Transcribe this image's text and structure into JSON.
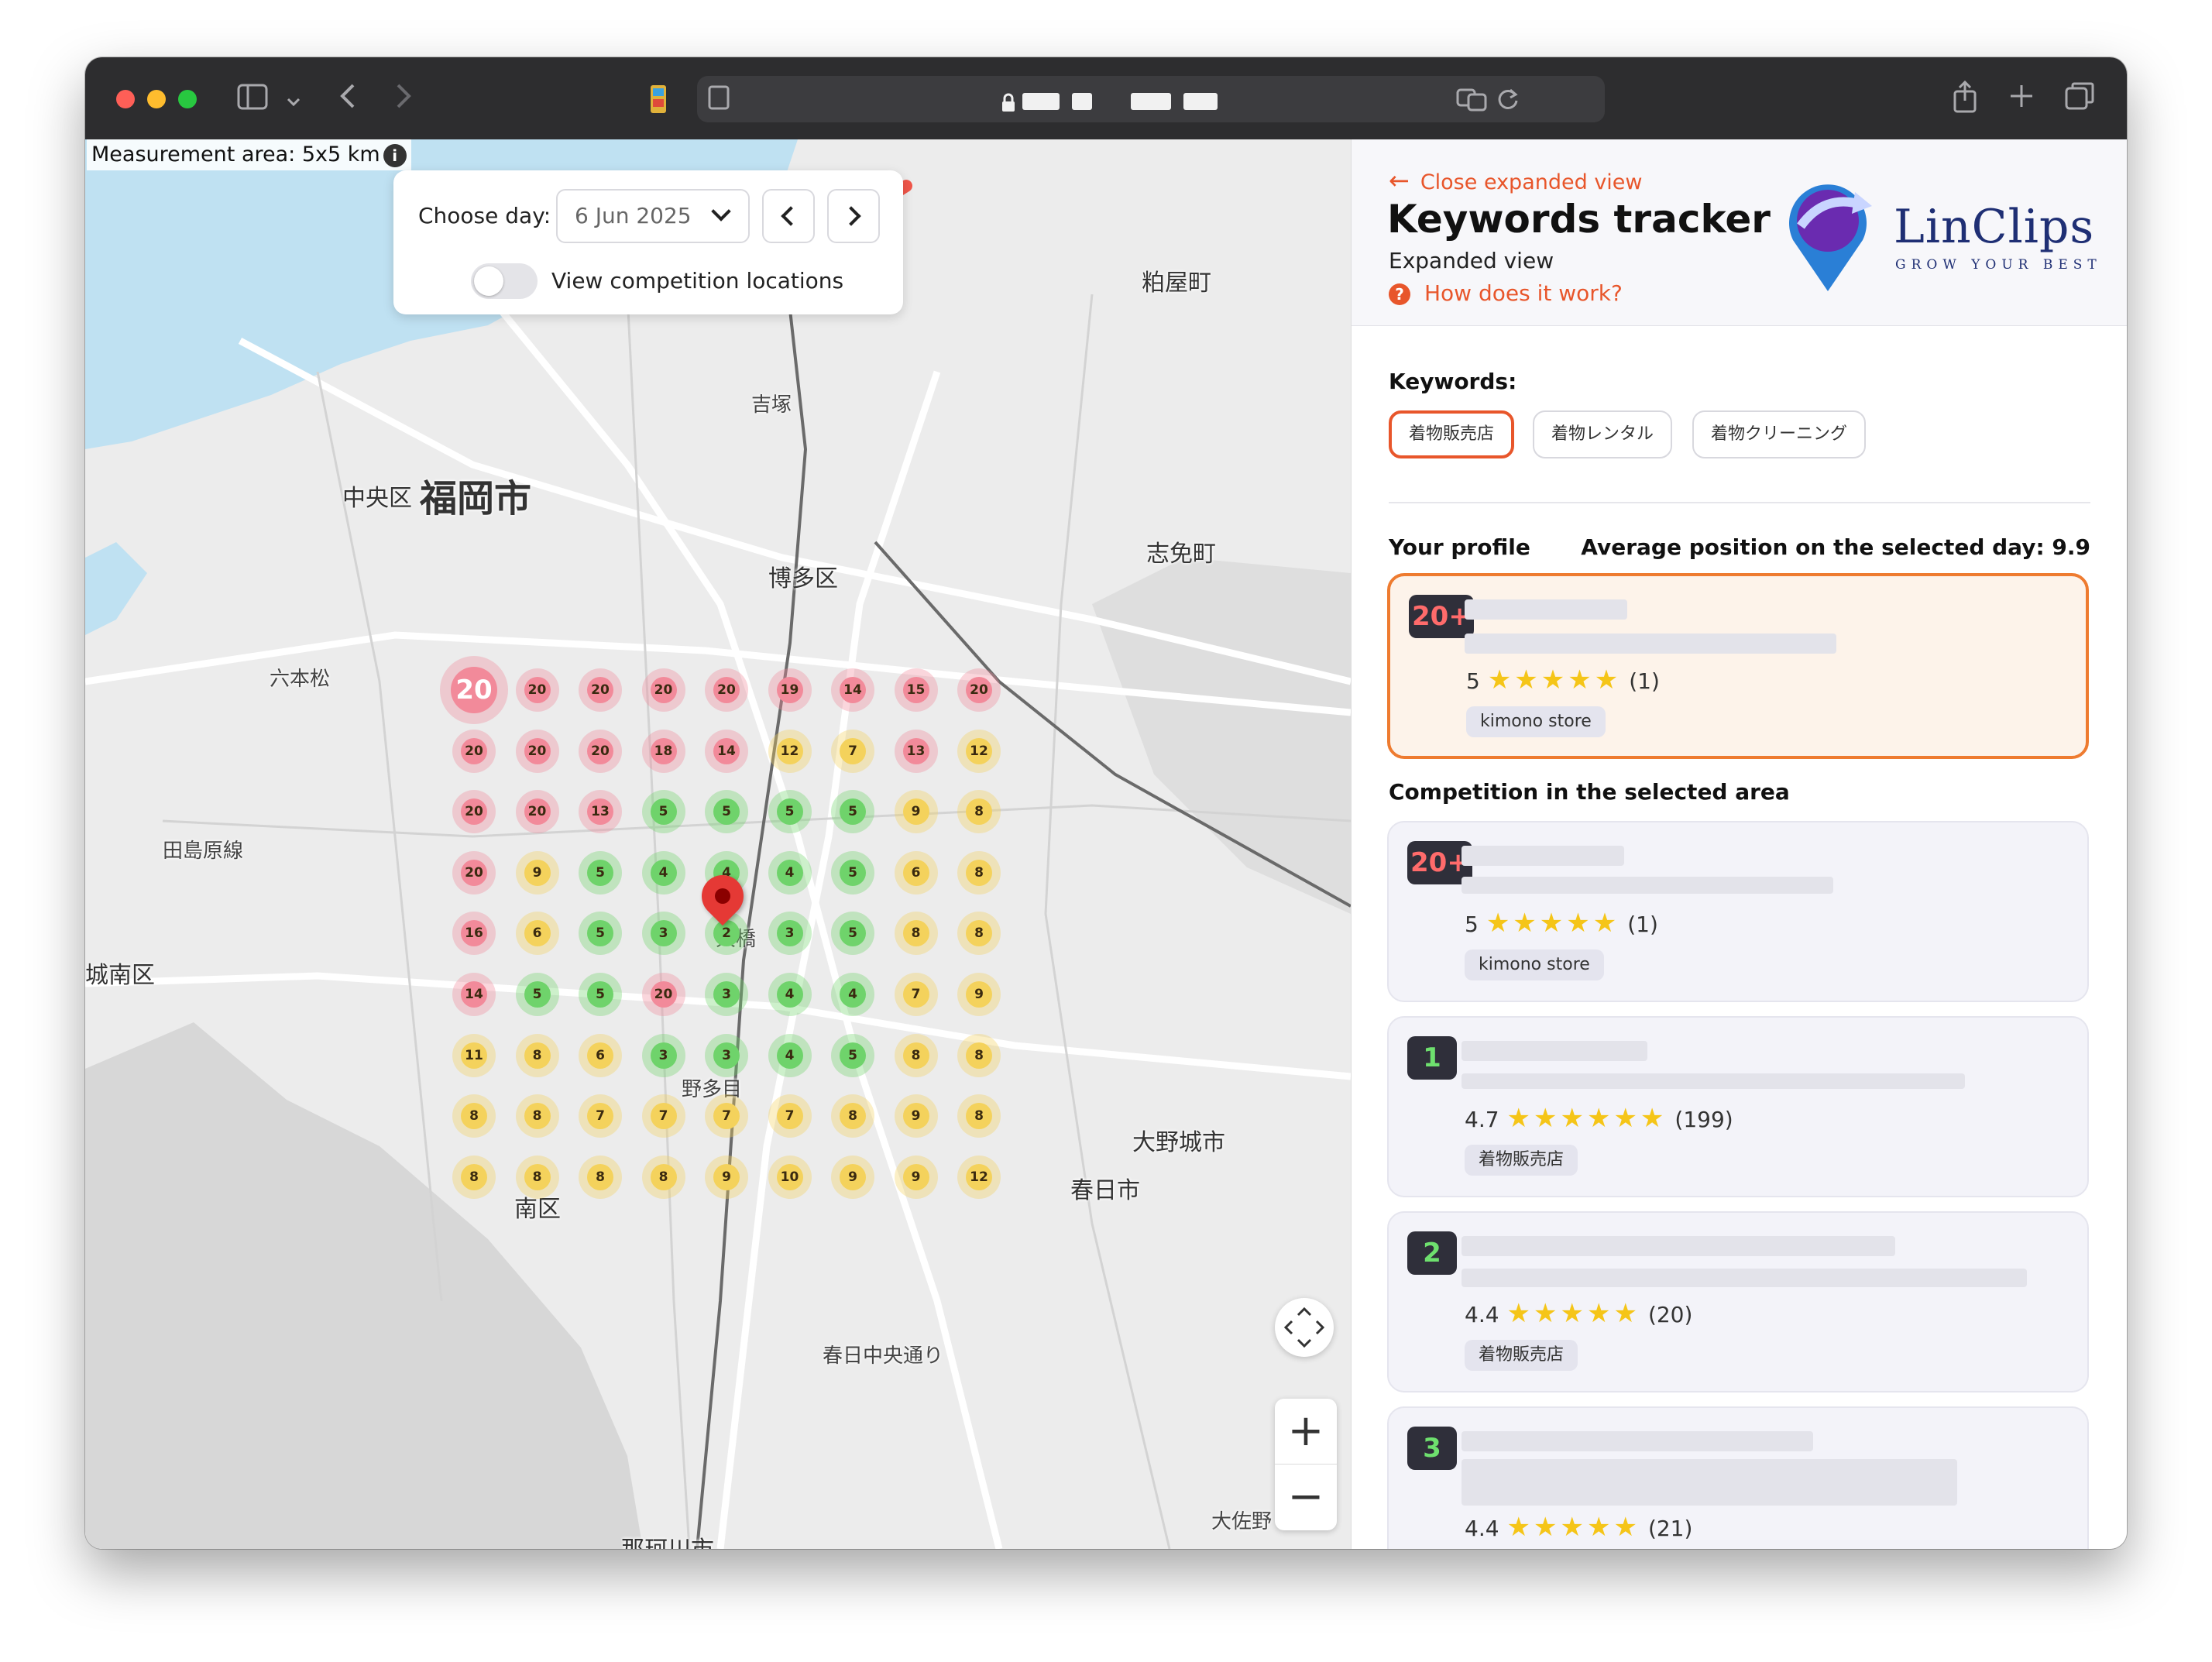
{
  "map": {
    "measurement_label": "Measurement area: 5x5 km",
    "info_icon": "info-icon",
    "day_label": "Choose day:",
    "day_value": "6 Jun 2025",
    "toggle_label": "View competition locations",
    "zoom_in": "+",
    "zoom_out": "−",
    "place_labels": {
      "fukuoka": "福岡市",
      "chuo": "中央区",
      "hakata": "博多区",
      "minami": "南区",
      "jonan": "城南区",
      "kasuga": "春日市",
      "onojo": "大野城市",
      "nakagawa": "那珂川市",
      "shime": "志免町",
      "sasaguri": "粕屋町",
      "yoshizuka": "吉塚",
      "rokuhonmatsu": "六本松",
      "ohashi": "大橋",
      "nonoichi": "野多目",
      "tamura": "田島原線",
      "kasuga_chuo": "春日中央通り",
      "osano": "大佐野"
    },
    "grid": [
      [
        20,
        20,
        20,
        20,
        20,
        19,
        14,
        15,
        20
      ],
      [
        20,
        20,
        20,
        18,
        14,
        12,
        7,
        13,
        12
      ],
      [
        20,
        20,
        13,
        5,
        5,
        5,
        5,
        9,
        8
      ],
      [
        20,
        9,
        5,
        4,
        4,
        4,
        5,
        6,
        8
      ],
      [
        16,
        6,
        5,
        3,
        2,
        3,
        5,
        8,
        8
      ],
      [
        14,
        5,
        5,
        20,
        3,
        4,
        4,
        7,
        9
      ],
      [
        11,
        8,
        6,
        3,
        3,
        4,
        5,
        8,
        8
      ],
      [
        8,
        8,
        7,
        7,
        7,
        7,
        8,
        9,
        8
      ],
      [
        8,
        8,
        8,
        8,
        9,
        10,
        9,
        9,
        12
      ]
    ],
    "colors": {
      "red": "#f28a9a",
      "yellow": "#f4d25c",
      "green": "#6fd36b"
    }
  },
  "panel": {
    "close_label": "Close expanded view",
    "title": "Keywords tracker",
    "subtitle": "Expanded view",
    "how_label": "How does it work?",
    "logo_text": "LinClips",
    "logo_tagline": "GROW YOUR BEST",
    "keywords_label": "Keywords:",
    "keywords": [
      "着物販売店",
      "着物レンタル",
      "着物クリーニング"
    ],
    "your_profile_label": "Your profile",
    "avg_label": "Average position on the selected day: 9.9",
    "competition_label": "Competition in the selected area",
    "profile": {
      "rank": "20+",
      "rating": "5",
      "count": "(1)",
      "tag": "kimono store"
    },
    "competitors": [
      {
        "rank": "20+",
        "rating": "5",
        "count": "(1)",
        "tag": "kimono store"
      },
      {
        "rank": "1",
        "rating": "4.7",
        "count": "(199)",
        "tag": "着物販売店"
      },
      {
        "rank": "2",
        "rating": "4.4",
        "count": "(20)",
        "tag": "着物販売店"
      },
      {
        "rank": "3",
        "rating": "4.4",
        "count": "(21)",
        "tag": ""
      }
    ],
    "accent_color": "#e8562b"
  }
}
